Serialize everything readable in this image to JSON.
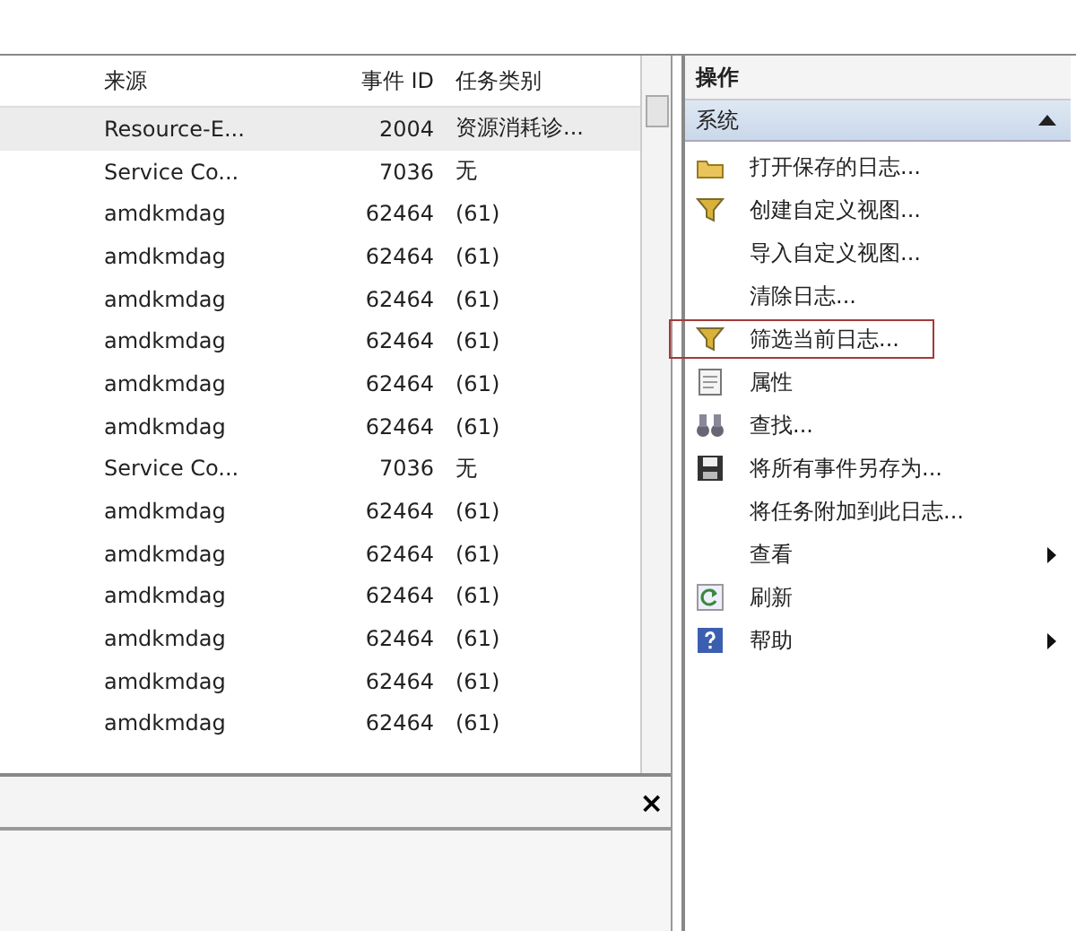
{
  "event_list": {
    "columns": [
      "来源",
      "事件 ID",
      "任务类别"
    ],
    "rows": [
      {
        "source": "Resource-E...",
        "event_id": "2004",
        "task_category": "资源消耗诊...",
        "selected": true
      },
      {
        "source": "Service Co...",
        "event_id": "7036",
        "task_category": "无",
        "selected": false
      },
      {
        "source": "amdkmdag",
        "event_id": "62464",
        "task_category": "(61)",
        "selected": false
      },
      {
        "source": "amdkmdag",
        "event_id": "62464",
        "task_category": "(61)",
        "selected": false
      },
      {
        "source": "amdkmdag",
        "event_id": "62464",
        "task_category": "(61)",
        "selected": false
      },
      {
        "source": "amdkmdag",
        "event_id": "62464",
        "task_category": "(61)",
        "selected": false
      },
      {
        "source": "amdkmdag",
        "event_id": "62464",
        "task_category": "(61)",
        "selected": false
      },
      {
        "source": "amdkmdag",
        "event_id": "62464",
        "task_category": "(61)",
        "selected": false
      },
      {
        "source": "Service Co...",
        "event_id": "7036",
        "task_category": "无",
        "selected": false
      },
      {
        "source": "amdkmdag",
        "event_id": "62464",
        "task_category": "(61)",
        "selected": false
      },
      {
        "source": "amdkmdag",
        "event_id": "62464",
        "task_category": "(61)",
        "selected": false
      },
      {
        "source": "amdkmdag",
        "event_id": "62464",
        "task_category": "(61)",
        "selected": false
      },
      {
        "source": "amdkmdag",
        "event_id": "62464",
        "task_category": "(61)",
        "selected": false
      },
      {
        "source": "amdkmdag",
        "event_id": "62464",
        "task_category": "(61)",
        "selected": false
      },
      {
        "source": "amdkmdag",
        "event_id": "62464",
        "task_category": "(61)",
        "selected": false
      }
    ]
  },
  "details_pane": {
    "close": "×"
  },
  "actions_pane": {
    "title": "操作",
    "section": {
      "label": "系统",
      "expanded": true
    },
    "items": [
      {
        "label": "打开保存的日志...",
        "kind": "open",
        "submenu": false,
        "highlighted": false
      },
      {
        "label": "创建自定义视图...",
        "kind": "filter",
        "submenu": false,
        "highlighted": false
      },
      {
        "label": "导入自定义视图...",
        "kind": "none",
        "submenu": false,
        "highlighted": false
      },
      {
        "label": "清除日志...",
        "kind": "none",
        "submenu": false,
        "highlighted": false
      },
      {
        "label": "筛选当前日志...",
        "kind": "filter",
        "submenu": false,
        "highlighted": true
      },
      {
        "label": "属性",
        "kind": "properties",
        "submenu": false,
        "highlighted": false
      },
      {
        "label": "查找...",
        "kind": "find",
        "submenu": false,
        "highlighted": false
      },
      {
        "label": "将所有事件另存为...",
        "kind": "save",
        "submenu": false,
        "highlighted": false
      },
      {
        "label": "将任务附加到此日志...",
        "kind": "none",
        "submenu": false,
        "highlighted": false
      },
      {
        "label": "查看",
        "kind": "none",
        "submenu": true,
        "highlighted": false
      },
      {
        "label": "刷新",
        "kind": "refresh",
        "submenu": false,
        "highlighted": false
      },
      {
        "label": "帮助",
        "kind": "help",
        "submenu": true,
        "highlighted": false
      }
    ]
  }
}
